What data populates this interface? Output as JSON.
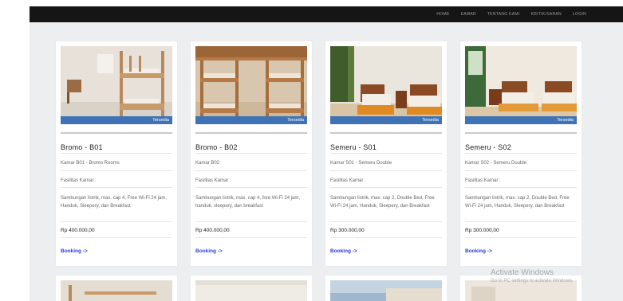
{
  "nav": {
    "items": [
      "HOME",
      "KAMAR",
      "TENTANG KAMI",
      "KRITIK/SARAN",
      "LOGIN"
    ]
  },
  "rooms": [
    {
      "badge": "Tersedia",
      "title": "Bromo - B01",
      "subtitle": "Kamar B01 - Bromo Rooms",
      "facilities_label": "Fasilitas Kamar :",
      "facilities": "Sambungan listrik, max. cap 4, Free Wi-Fi 24 jam, Handuk, Sleepery, dan Breakfast",
      "price": "Rp 400.000,00",
      "booking": "Booking ->"
    },
    {
      "badge": "Tersedia",
      "title": "Bromo - B02",
      "subtitle": "Kamar B02",
      "facilities_label": "Fasilitas Kamar :",
      "facilities": "Sambungan listrik, max. cap 4, free Wi-Fi 24 jam, handuk, sleepery, dan breakfast",
      "price": "Rp 400.000,00",
      "booking": "Booking ->"
    },
    {
      "badge": "Tersedia",
      "title": "Semeru - S01",
      "subtitle": "Kamar S01 - Semeru Double",
      "facilities_label": "Fasilitas Kamar :",
      "facilities": "Sambungan listrik, max. cap 2, Double Bed, Free Wi-Fi 24 jam, Handuk, Sleepery, dan Breakfast",
      "price": "Rp 300.000,00",
      "booking": "Booking ->"
    },
    {
      "badge": "Tersedia",
      "title": "Semeru - S02",
      "subtitle": "Kamar S02 - Semeru Double",
      "facilities_label": "Fasilitas Kamar :",
      "facilities": "Sambungan listrik, max. cap 2, Double Bed, Free Wi-Fi 24 jam, Handuk, Sleepery, dan Breakfast",
      "price": "Rp 300.000,00",
      "booking": "Booking ->"
    }
  ],
  "watermark": {
    "line1": "Activate Windows",
    "line2": "Go to PC settings to activate Windows."
  }
}
